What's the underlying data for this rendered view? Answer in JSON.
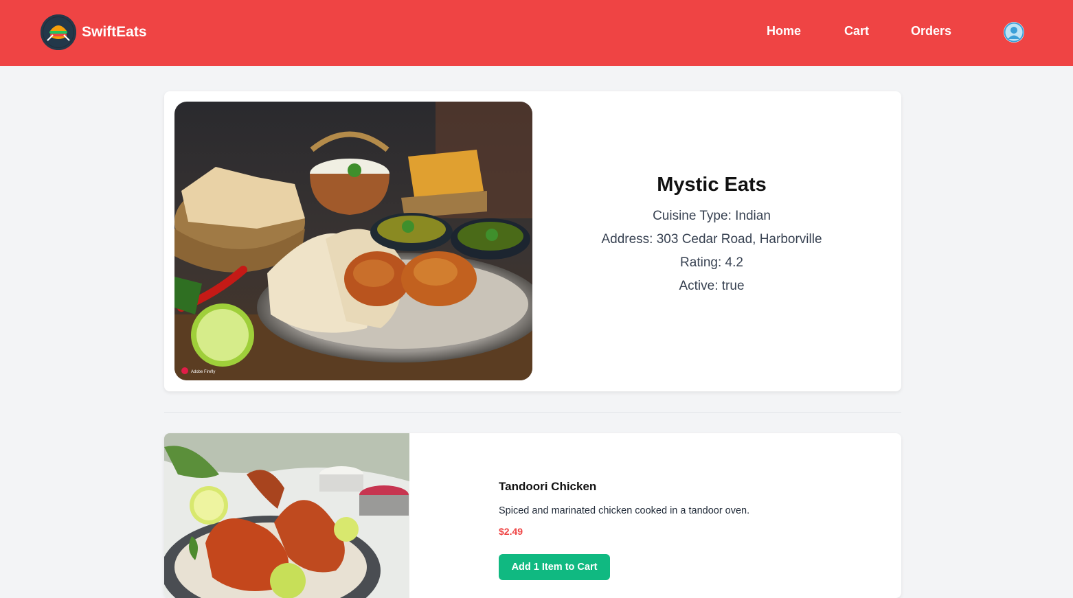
{
  "navbar": {
    "brand": "SwiftEats",
    "links": [
      "Home",
      "Cart",
      "Orders"
    ],
    "icons": {
      "logo": "food-logo-icon",
      "profile": "user-avatar-icon"
    },
    "color": "#ef4444"
  },
  "restaurant": {
    "name": "Mystic Eats",
    "cuisine": "Cuisine Type: Indian",
    "address": "Address: 303 Cedar Road, Harborville",
    "rating": "Rating: 4.2",
    "active": "Active: true",
    "image_watermark": "Adobe Firefly"
  },
  "menu_item": {
    "name": "Tandoori Chicken",
    "description": "Spiced and marinated chicken cooked in a tandoor oven.",
    "price": "$2.49",
    "button_label": "Add 1 Item to Cart",
    "button_color": "#10b981"
  }
}
